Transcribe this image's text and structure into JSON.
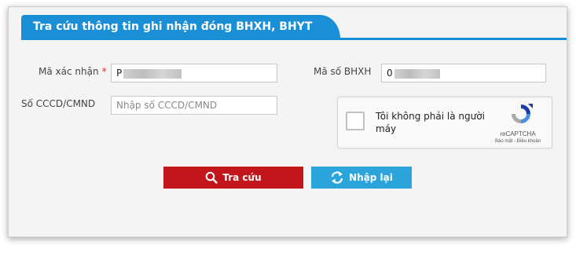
{
  "form": {
    "title": "Tra cứu thông tin ghi nhận đóng BHXH, BHYT",
    "confirm_code_label": "Mã xác nhận",
    "required_mark": "*",
    "confirm_code_value": "P",
    "bhxh_label": "Mã số BHXH",
    "bhxh_value": "0",
    "cccd_label": "Số CCCD/CMND",
    "cccd_placeholder": "Nhập số CCCD/CMND"
  },
  "recaptcha": {
    "text": "Tôi không phải là người máy",
    "brand": "reCAPTCHA",
    "terms": "Bảo mật - Điều khoản"
  },
  "buttons": {
    "search_label": "Tra cứu",
    "reset_label": "Nhập lại"
  },
  "colors": {
    "header_blue": "#1a8fd6",
    "search_red": "#c3161c",
    "reset_blue": "#2ba4dc"
  },
  "icons": {
    "search": "magnifier-icon",
    "reset": "refresh-icon",
    "recaptcha": "recaptcha-logo-icon"
  }
}
